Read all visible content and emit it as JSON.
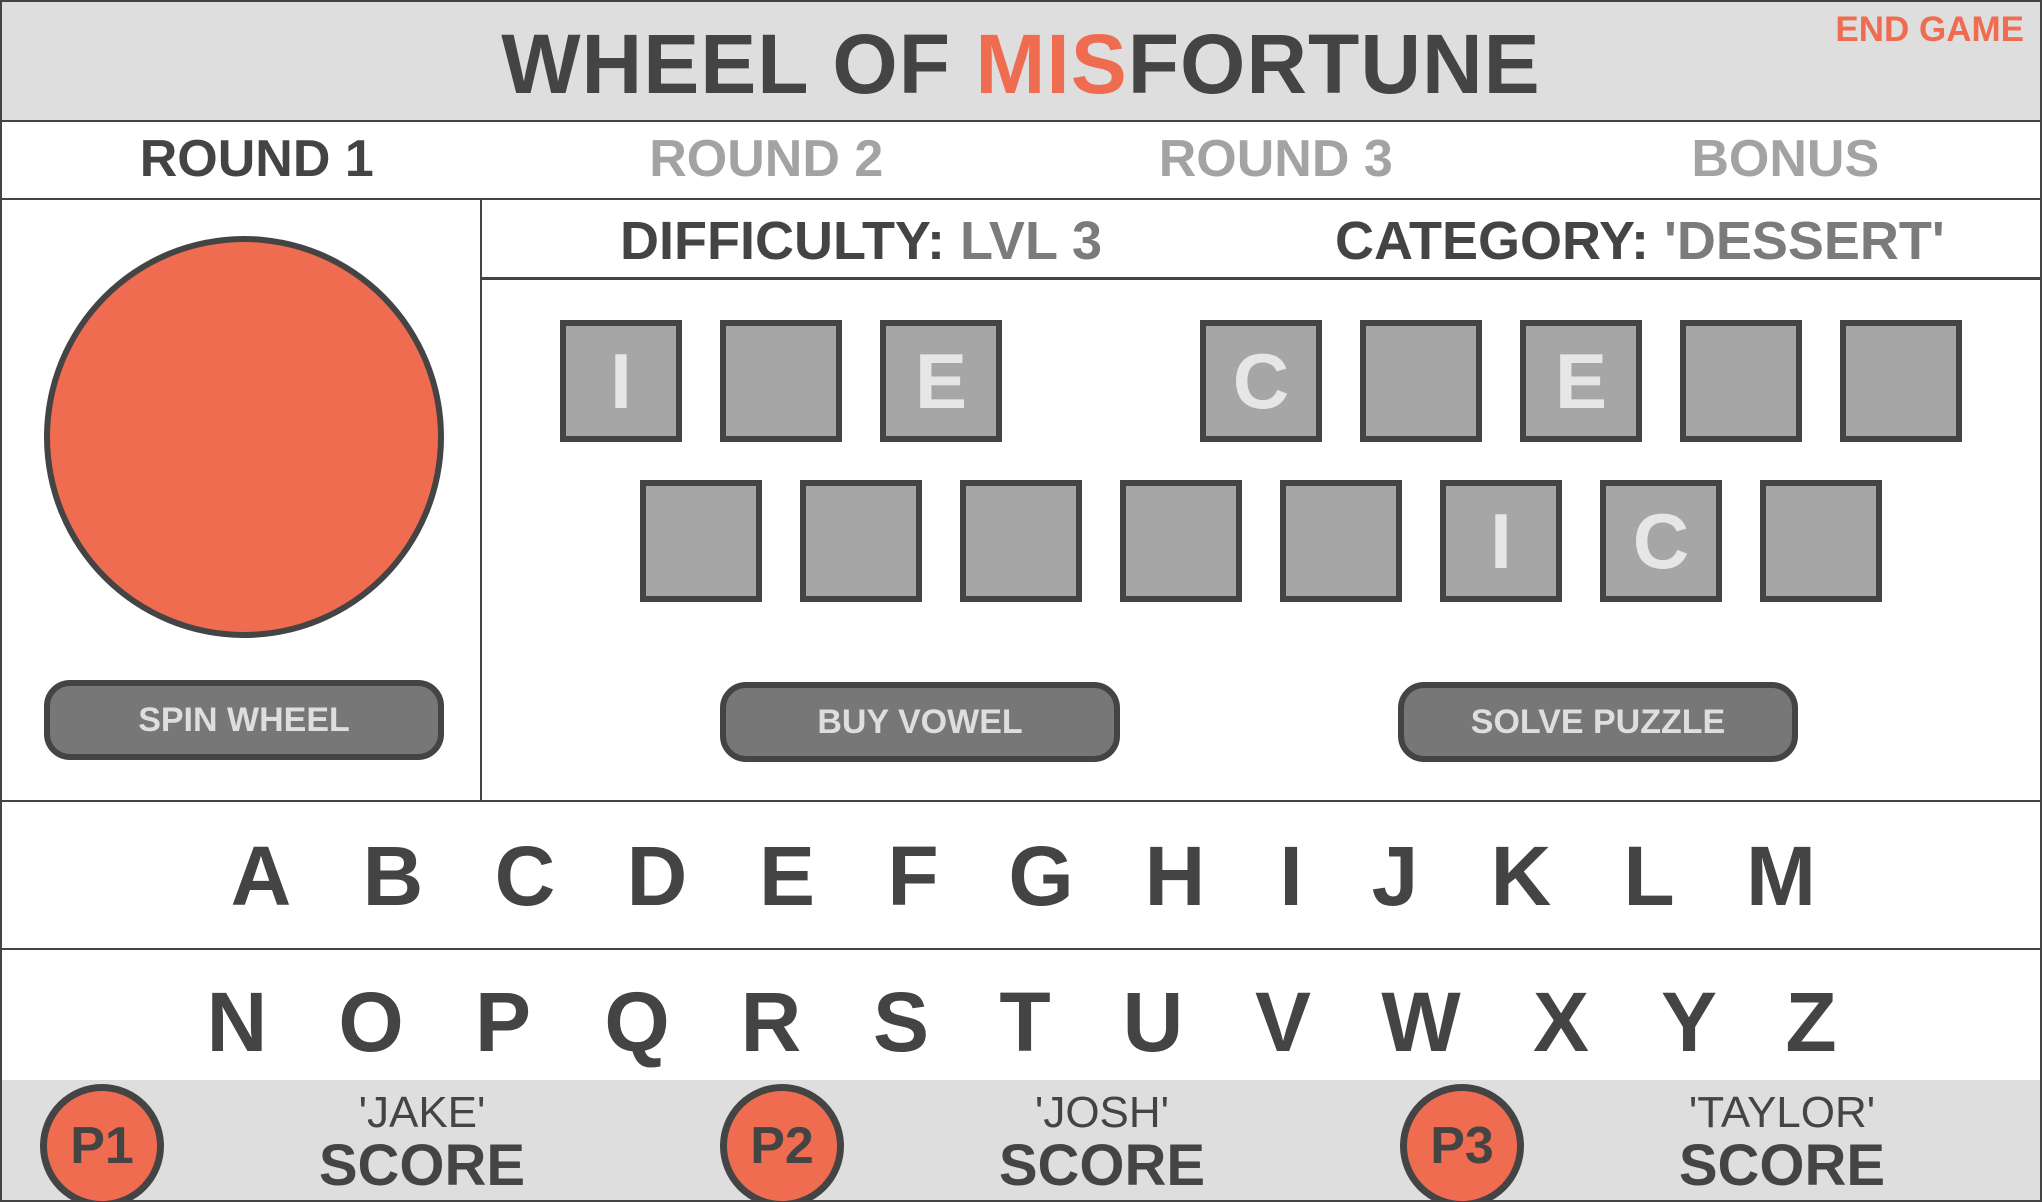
{
  "header": {
    "title_part1": "WHEEL OF ",
    "title_accent": "MIS",
    "title_part2": "FORTUNE",
    "end_game_label": "END GAME"
  },
  "rounds": [
    {
      "label": "ROUND 1",
      "active": true
    },
    {
      "label": "ROUND 2",
      "active": false
    },
    {
      "label": "ROUND 3",
      "active": false
    },
    {
      "label": "BONUS",
      "active": false
    }
  ],
  "info": {
    "difficulty_label": "DIFFICULTY:",
    "difficulty_value": "LVL 3",
    "category_label": "CATEGORY:",
    "category_value": "'DESSERT'"
  },
  "puzzle": {
    "row1": [
      "I",
      "",
      "E",
      "C",
      "",
      "E",
      "",
      ""
    ],
    "row2": [
      "",
      "",
      "",
      "",
      "",
      "I",
      "C",
      ""
    ]
  },
  "actions": {
    "spin_label": "SPIN WHEEL",
    "buy_vowel_label": "BUY VOWEL",
    "solve_label": "SOLVE PUZZLE"
  },
  "letters": {
    "row1": [
      "A",
      "B",
      "C",
      "D",
      "E",
      "F",
      "G",
      "H",
      "I",
      "J",
      "K",
      "L",
      "M"
    ],
    "row2": [
      "N",
      "O",
      "P",
      "Q",
      "R",
      "S",
      "T",
      "U",
      "V",
      "W",
      "X",
      "Y",
      "Z"
    ]
  },
  "players": [
    {
      "badge": "P1",
      "name": "'JAKE'",
      "score_label": "SCORE"
    },
    {
      "badge": "P2",
      "name": "'JOSH'",
      "score_label": "SCORE"
    },
    {
      "badge": "P3",
      "name": "'TAYLOR'",
      "score_label": "SCORE"
    }
  ],
  "colors": {
    "accent": "#ef6c51",
    "dark": "#444444",
    "header_bg": "#dedede",
    "tile_bg": "#a6a6a6",
    "button_bg": "#777777",
    "inactive_text": "#a3a3a3"
  }
}
